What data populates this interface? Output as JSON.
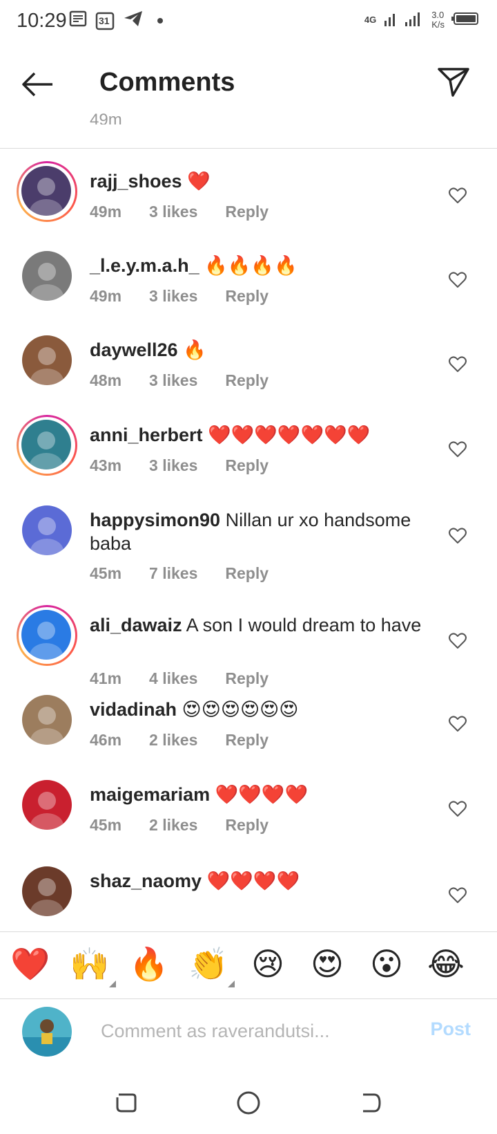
{
  "status_bar": {
    "time": "10:29",
    "calendar_day": "31",
    "network": "4G",
    "speed_value": "3.0",
    "speed_unit": "K/s"
  },
  "header": {
    "title": "Comments"
  },
  "previous_comment_time": "49m",
  "comments": [
    {
      "username": "rajj_shoes",
      "text": "❤️",
      "time": "49m",
      "likes": "3 likes",
      "reply": "Reply",
      "ring": true,
      "avatar_color": "#4b3d6b"
    },
    {
      "username": "_l.e.y.m.a.h_",
      "text": "🔥🔥🔥🔥",
      "time": "49m",
      "likes": "3 likes",
      "reply": "Reply",
      "ring": false,
      "avatar_color": "#7a7a7a"
    },
    {
      "username": "daywell26",
      "text": "🔥",
      "time": "48m",
      "likes": "3 likes",
      "reply": "Reply",
      "ring": false,
      "avatar_color": "#8a5a3c"
    },
    {
      "username": "anni_herbert",
      "text": "❤️❤️❤️❤️❤️❤️❤️",
      "time": "43m",
      "likes": "3 likes",
      "reply": "Reply",
      "ring": true,
      "avatar_color": "#2f7f8f"
    },
    {
      "username": "happysimon90",
      "text": "Nillan ur xo handsome baba",
      "time": "45m",
      "likes": "7 likes",
      "reply": "Reply",
      "ring": false,
      "avatar_color": "#5b6bd6"
    },
    {
      "username": "ali_dawaiz",
      "text": "A son I would dream to have",
      "time": "41m",
      "likes": "4 likes",
      "reply": "Reply",
      "ring": true,
      "avatar_color": "#2a7be4"
    },
    {
      "username": "vidadinah",
      "text": "😍😍😍😍😍😍",
      "time": "46m",
      "likes": "2 likes",
      "reply": "Reply",
      "ring": false,
      "avatar_color": "#9c7d5e"
    },
    {
      "username": "maigemariam",
      "text": "❤️❤️❤️❤️",
      "time": "45m",
      "likes": "2 likes",
      "reply": "Reply",
      "ring": false,
      "avatar_color": "#c9202f"
    },
    {
      "username": "shaz_naomy",
      "text": "❤️❤️❤️❤️",
      "time": "",
      "likes": "",
      "reply": "",
      "ring": false,
      "avatar_color": "#6b3b2a"
    }
  ],
  "quick_emojis": [
    "❤️",
    "🙌",
    "🔥",
    "👏",
    "😢",
    "😍",
    "😮",
    "😂"
  ],
  "composer": {
    "placeholder": "Comment as raverandutsi...",
    "post_label": "Post"
  },
  "colors": {
    "accent_disabled": "#b3dbff",
    "meta_gray": "#8e8e8e"
  }
}
